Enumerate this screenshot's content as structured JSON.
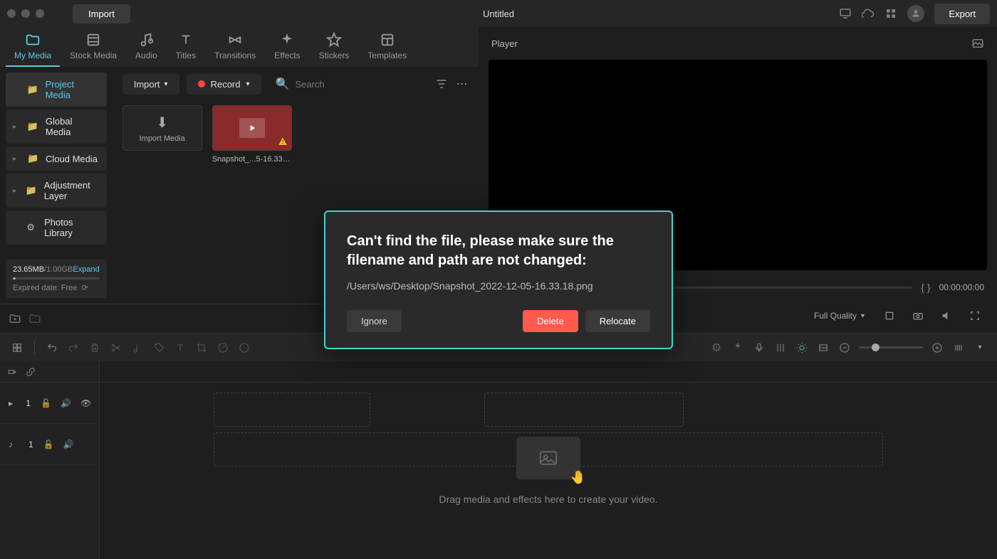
{
  "titlebar": {
    "import_label": "Import",
    "title": "Untitled",
    "export_label": "Export"
  },
  "tabs": [
    {
      "label": "My Media",
      "active": true
    },
    {
      "label": "Stock Media",
      "active": false
    },
    {
      "label": "Audio",
      "active": false
    },
    {
      "label": "Titles",
      "active": false
    },
    {
      "label": "Transitions",
      "active": false
    },
    {
      "label": "Effects",
      "active": false
    },
    {
      "label": "Stickers",
      "active": false
    },
    {
      "label": "Templates",
      "active": false
    }
  ],
  "sidebar": {
    "folders": [
      {
        "label": "Project Media",
        "active": true,
        "expandable": false
      },
      {
        "label": "Global Media",
        "active": false,
        "expandable": true
      },
      {
        "label": "Cloud Media",
        "active": false,
        "expandable": true
      },
      {
        "label": "Adjustment Layer",
        "active": false,
        "expandable": true
      },
      {
        "label": "Photos Library",
        "active": false,
        "expandable": false,
        "icon": "gear"
      }
    ],
    "storage": {
      "used": "23.65MB",
      "total": "/1.00GB",
      "expand": "Expand",
      "expired": "Expired date: Free"
    }
  },
  "toolbar": {
    "import_label": "Import",
    "record_label": "Record",
    "search_placeholder": "Search"
  },
  "media": {
    "import_card": "Import Media",
    "items": [
      {
        "name": "Snapshot_...5-16.33.18"
      }
    ]
  },
  "player": {
    "title": "Player",
    "time": "00:00:00:00",
    "quality": "Full Quality"
  },
  "timeline": {
    "drop_hint": "Drag media and effects here to create your video.",
    "tracks": [
      {
        "type": "video",
        "num": "1"
      },
      {
        "type": "audio",
        "num": "1"
      }
    ]
  },
  "modal": {
    "title": "Can't find the file, please make sure the filename and path are not changed:",
    "path": "/Users/ws/Desktop/Snapshot_2022-12-05-16.33.18.png",
    "ignore": "Ignore",
    "delete": "Delete",
    "relocate": "Relocate"
  }
}
